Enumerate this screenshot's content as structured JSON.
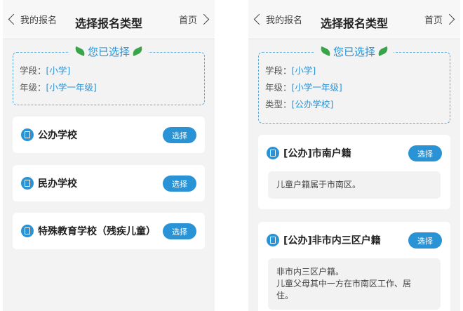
{
  "left": {
    "nav": {
      "back_label": "我的报名",
      "title": "选择报名类型",
      "home_label": "首页"
    },
    "selected": {
      "heading": "您已选择",
      "rows": [
        {
          "label": "学段：",
          "value": "[小学]"
        },
        {
          "label": "年级：",
          "value": "[小学一年级]"
        }
      ]
    },
    "options": [
      {
        "title": "公办学校",
        "button": "选择"
      },
      {
        "title": "民办学校",
        "button": "选择"
      },
      {
        "title": "特殊教育学校（残疾儿童）",
        "button": "选择"
      }
    ]
  },
  "right": {
    "nav": {
      "back_label": "我的报名",
      "title": "选择报名类型",
      "home_label": "首页"
    },
    "selected": {
      "heading": "您已选择",
      "rows": [
        {
          "label": "学段：",
          "value": "[小学]"
        },
        {
          "label": "年级：",
          "value": "[小学一年级]"
        },
        {
          "label": "类型：",
          "value": "[公办学校]"
        }
      ]
    },
    "options": [
      {
        "title": "[公办]市南户籍",
        "button": "选择",
        "desc": [
          "儿童户籍属于市南区。"
        ]
      },
      {
        "title": "[公办]非市内三区户籍",
        "button": "选择",
        "desc": [
          "非市内三区户籍。",
          "儿童父母其中一方在市南区工作、居",
          "住。"
        ]
      }
    ]
  },
  "colors": {
    "accent": "#2a93d5",
    "leaf": "#3aa44a",
    "background": "#f3f3f3"
  },
  "icons": {
    "back": "chevron-left-icon",
    "home": "chevron-right-icon",
    "option": "document-icon",
    "decor": "leaf-icon"
  }
}
